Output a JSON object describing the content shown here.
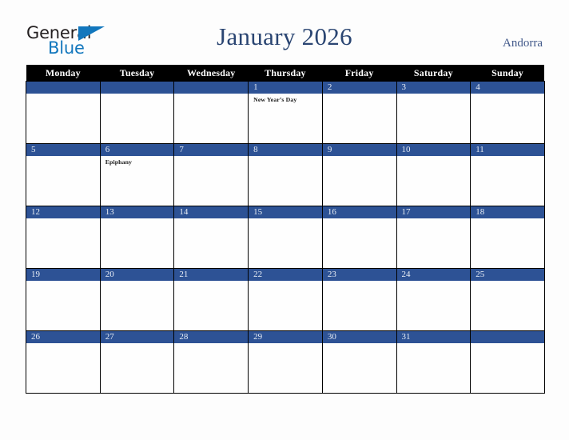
{
  "brand": {
    "name_part1": "General",
    "name_part2": "Blue",
    "triangle_color": "#1277bd",
    "text_color": "#231f20"
  },
  "header": {
    "title": "January 2026",
    "country": "Andorra",
    "title_color": "#2a4572",
    "country_color": "#42598a"
  },
  "calendar": {
    "month": "January",
    "year": "2026",
    "accent_color": "#2d5295",
    "header_bg": "#000000",
    "weekdays": [
      "Monday",
      "Tuesday",
      "Wednesday",
      "Thursday",
      "Friday",
      "Saturday",
      "Sunday"
    ],
    "weeks": [
      [
        {
          "date": "",
          "event": ""
        },
        {
          "date": "",
          "event": ""
        },
        {
          "date": "",
          "event": ""
        },
        {
          "date": "1",
          "event": "New Year’s Day"
        },
        {
          "date": "2",
          "event": ""
        },
        {
          "date": "3",
          "event": ""
        },
        {
          "date": "4",
          "event": ""
        }
      ],
      [
        {
          "date": "5",
          "event": ""
        },
        {
          "date": "6",
          "event": "Epiphany"
        },
        {
          "date": "7",
          "event": ""
        },
        {
          "date": "8",
          "event": ""
        },
        {
          "date": "9",
          "event": ""
        },
        {
          "date": "10",
          "event": ""
        },
        {
          "date": "11",
          "event": ""
        }
      ],
      [
        {
          "date": "12",
          "event": ""
        },
        {
          "date": "13",
          "event": ""
        },
        {
          "date": "14",
          "event": ""
        },
        {
          "date": "15",
          "event": ""
        },
        {
          "date": "16",
          "event": ""
        },
        {
          "date": "17",
          "event": ""
        },
        {
          "date": "18",
          "event": ""
        }
      ],
      [
        {
          "date": "19",
          "event": ""
        },
        {
          "date": "20",
          "event": ""
        },
        {
          "date": "21",
          "event": ""
        },
        {
          "date": "22",
          "event": ""
        },
        {
          "date": "23",
          "event": ""
        },
        {
          "date": "24",
          "event": ""
        },
        {
          "date": "25",
          "event": ""
        }
      ],
      [
        {
          "date": "26",
          "event": ""
        },
        {
          "date": "27",
          "event": ""
        },
        {
          "date": "28",
          "event": ""
        },
        {
          "date": "29",
          "event": ""
        },
        {
          "date": "30",
          "event": ""
        },
        {
          "date": "31",
          "event": ""
        },
        {
          "date": "",
          "event": ""
        }
      ]
    ]
  }
}
